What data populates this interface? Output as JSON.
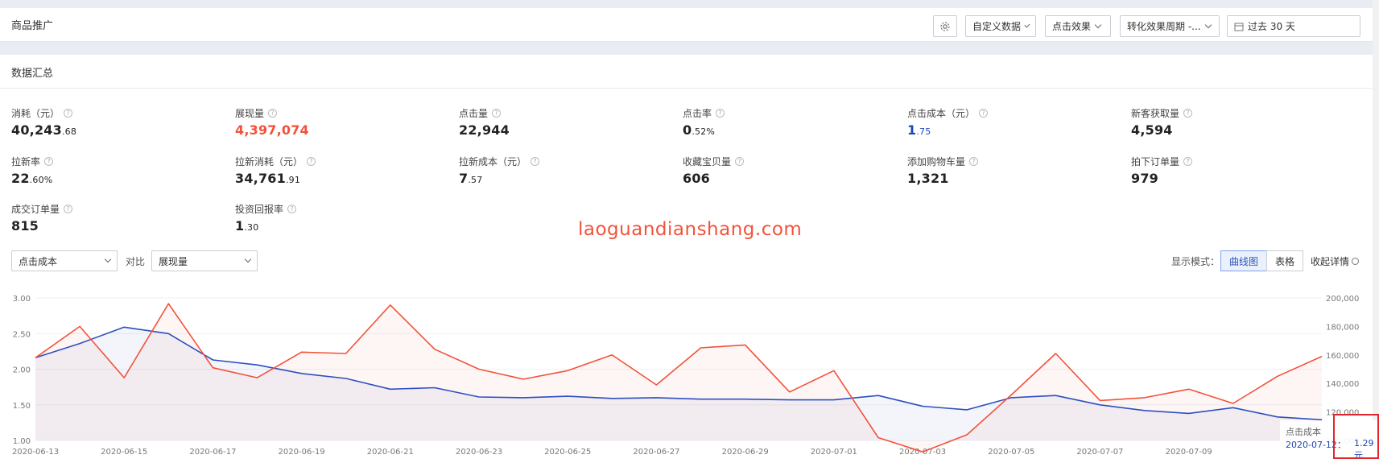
{
  "header": {
    "title": "商品推广",
    "custom_data": "自定义数据",
    "click_effect": "点击效果",
    "conversion_period": "转化效果周期 -...",
    "date_range": "过去 30 天"
  },
  "summary": {
    "title": "数据汇总",
    "metrics": [
      {
        "label": "消耗（元）",
        "int": "40,243",
        "dec": ".68"
      },
      {
        "label": "展现量",
        "int": "4,397,074",
        "dec": ""
      },
      {
        "label": "点击量",
        "int": "22,944",
        "dec": ""
      },
      {
        "label": "点击率",
        "int": "0",
        "dec": ".52%"
      },
      {
        "label": "点击成本（元）",
        "int": "1",
        "dec": ".75"
      },
      {
        "label": "新客获取量",
        "int": "4,594",
        "dec": ""
      },
      {
        "label": "拉新率",
        "int": "22",
        "dec": ".60%"
      },
      {
        "label": "拉新消耗（元）",
        "int": "34,761",
        "dec": ".91"
      },
      {
        "label": "拉新成本（元）",
        "int": "7",
        "dec": ".57"
      },
      {
        "label": "收藏宝贝量",
        "int": "606",
        "dec": ""
      },
      {
        "label": "添加购物车量",
        "int": "1,321",
        "dec": ""
      },
      {
        "label": "拍下订单量",
        "int": "979",
        "dec": ""
      },
      {
        "label": "成交订单量",
        "int": "815",
        "dec": ""
      },
      {
        "label": "投资回报率",
        "int": "1",
        "dec": ".30"
      }
    ]
  },
  "watermark": "laoguandianshang.com",
  "controls": {
    "primary_metric": "点击成本",
    "compare_label": "对比",
    "compare_metric": "展现量",
    "mode_label": "显示模式：",
    "mode_curve": "曲线图",
    "mode_table": "表格",
    "collapse": "收起详情"
  },
  "tooltip": {
    "title": "点击成本",
    "date": "2020-07-12",
    "sep": "：",
    "value": "1.29元"
  },
  "colors": {
    "primary_series": "#2d4fc0",
    "compare_series": "#f2523a",
    "highlight_value": "#f2523a"
  },
  "chart_data": {
    "type": "line",
    "x": [
      "2020-06-13",
      "2020-06-14",
      "2020-06-15",
      "2020-06-16",
      "2020-06-17",
      "2020-06-18",
      "2020-06-19",
      "2020-06-20",
      "2020-06-21",
      "2020-06-22",
      "2020-06-23",
      "2020-06-24",
      "2020-06-25",
      "2020-06-26",
      "2020-06-27",
      "2020-06-28",
      "2020-06-29",
      "2020-06-30",
      "2020-07-01",
      "2020-07-02",
      "2020-07-03",
      "2020-07-04",
      "2020-07-05",
      "2020-07-06",
      "2020-07-07",
      "2020-07-08",
      "2020-07-09",
      "2020-07-10",
      "2020-07-11",
      "2020-07-12"
    ],
    "x_tick_labels": [
      "2020-06-13",
      "2020-06-15",
      "2020-06-17",
      "2020-06-19",
      "2020-06-21",
      "2020-06-23",
      "2020-06-25",
      "2020-06-27",
      "2020-06-29",
      "2020-07-01",
      "2020-07-03",
      "2020-07-05",
      "2020-07-07",
      "2020-07-09"
    ],
    "series": [
      {
        "name": "点击成本",
        "axis": "left",
        "values": [
          2.16,
          2.36,
          2.59,
          2.5,
          2.13,
          2.06,
          1.94,
          1.87,
          1.72,
          1.74,
          1.61,
          1.6,
          1.62,
          1.59,
          1.6,
          1.58,
          1.58,
          1.57,
          1.57,
          1.63,
          1.48,
          1.43,
          1.6,
          1.63,
          1.5,
          1.42,
          1.38,
          1.46,
          1.33,
          1.29
        ]
      },
      {
        "name": "展现量",
        "axis": "right",
        "values": [
          158000,
          180000,
          144000,
          196000,
          151000,
          144000,
          162000,
          161000,
          195000,
          164000,
          150000,
          143000,
          149000,
          160000,
          139000,
          165000,
          167000,
          134000,
          149000,
          102000,
          92000,
          104000,
          132000,
          161000,
          128000,
          130000,
          136000,
          126000,
          145000,
          159000
        ]
      }
    ],
    "ylim_left": [
      1.0,
      3.0
    ],
    "yticks_left": [
      "3.00",
      "2.50",
      "2.00",
      "1.50",
      "1.00"
    ],
    "ylim_right": [
      100000,
      200000
    ],
    "yticks_right": [
      "200,000",
      "180,000",
      "160,000",
      "140,000",
      "120,000",
      "100,000"
    ],
    "grid": true,
    "legend": "none"
  }
}
